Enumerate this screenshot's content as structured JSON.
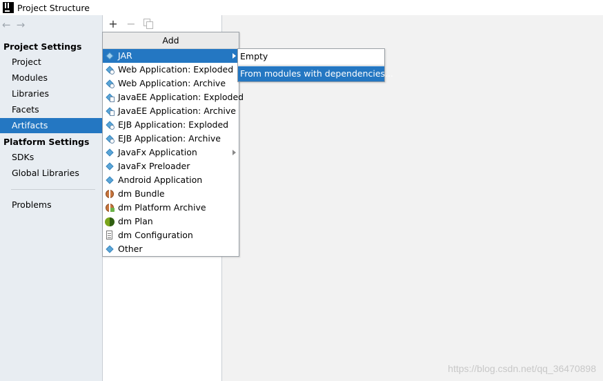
{
  "window": {
    "title": "Project Structure"
  },
  "nav": {
    "back_icon": "left-arrow-icon",
    "forward_icon": "right-arrow-icon"
  },
  "sidebar": {
    "project_settings_header": "Project Settings",
    "project_items": [
      {
        "label": "Project"
      },
      {
        "label": "Modules"
      },
      {
        "label": "Libraries"
      },
      {
        "label": "Facets"
      },
      {
        "label": "Artifacts",
        "selected": true
      }
    ],
    "platform_settings_header": "Platform Settings",
    "platform_items": [
      {
        "label": "SDKs"
      },
      {
        "label": "Global Libraries"
      }
    ],
    "problems_label": "Problems"
  },
  "toolbar": {
    "add_label": "+",
    "remove_label": "−"
  },
  "add_menu": {
    "header": "Add",
    "items": [
      {
        "label": "JAR",
        "icon": "artifact-diamond-icon",
        "submenu": true,
        "active": true
      },
      {
        "label": "Web Application: Exploded",
        "icon": "web-exploded-icon"
      },
      {
        "label": "Web Application: Archive",
        "icon": "web-archive-icon"
      },
      {
        "label": "JavaEE Application: Exploded",
        "icon": "javaee-exploded-icon"
      },
      {
        "label": "JavaEE Application: Archive",
        "icon": "javaee-archive-icon"
      },
      {
        "label": "EJB Application: Exploded",
        "icon": "ejb-exploded-icon"
      },
      {
        "label": "EJB Application: Archive",
        "icon": "ejb-archive-icon"
      },
      {
        "label": "JavaFx Application",
        "icon": "javafx-icon",
        "submenu": true
      },
      {
        "label": "JavaFx Preloader",
        "icon": "javafx-preloader-icon"
      },
      {
        "label": "Android Application",
        "icon": "android-icon"
      },
      {
        "label": "dm Bundle",
        "icon": "bundle-icon"
      },
      {
        "label": "dm Platform Archive",
        "icon": "platform-archive-icon"
      },
      {
        "label": "dm Plan",
        "icon": "plan-icon"
      },
      {
        "label": "dm Configuration",
        "icon": "configuration-icon"
      },
      {
        "label": "Other",
        "icon": "other-diamond-icon"
      }
    ]
  },
  "jar_submenu": {
    "items": [
      {
        "label": "Empty"
      },
      {
        "label": "From modules with dependencies...",
        "active": true
      }
    ]
  },
  "watermark": "https://blog.csdn.net/qq_36470898",
  "colors": {
    "selection": "#2477c2",
    "sidebar_bg": "#e8edf2",
    "content_bg": "#f2f2f2"
  }
}
